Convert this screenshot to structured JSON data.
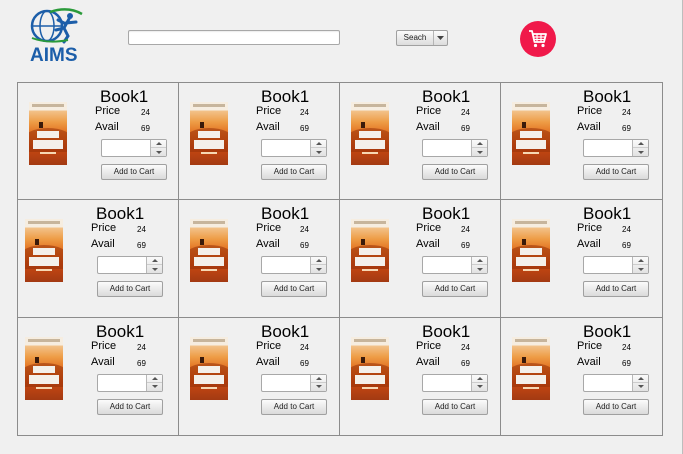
{
  "header": {
    "logo_text": "AIMS",
    "search_value": "",
    "search_button": "Seach",
    "cart_icon": "shopping-cart-icon",
    "cart_color": "#f0194a",
    "logo_color": "#1c5ea9"
  },
  "products": [
    {
      "title": "Book1",
      "price_label": "Price",
      "price": "24",
      "avail_label": "Avail",
      "avail": "69",
      "quantity": "",
      "add_label": "Add to Cart"
    },
    {
      "title": "Book1",
      "price_label": "Price",
      "price": "24",
      "avail_label": "Avail",
      "avail": "69",
      "quantity": "",
      "add_label": "Add to Cart"
    },
    {
      "title": "Book1",
      "price_label": "Price",
      "price": "24",
      "avail_label": "Avail",
      "avail": "69",
      "quantity": "",
      "add_label": "Add to Cart"
    },
    {
      "title": "Book1",
      "price_label": "Price",
      "price": "24",
      "avail_label": "Avail",
      "avail": "69",
      "quantity": "",
      "add_label": "Add to Cart"
    },
    {
      "title": "Book1",
      "price_label": "Price",
      "price": "24",
      "avail_label": "Avail",
      "avail": "69",
      "quantity": "",
      "add_label": "Add to Cart"
    },
    {
      "title": "Book1",
      "price_label": "Price",
      "price": "24",
      "avail_label": "Avail",
      "avail": "69",
      "quantity": "",
      "add_label": "Add to Cart"
    },
    {
      "title": "Book1",
      "price_label": "Price",
      "price": "24",
      "avail_label": "Avail",
      "avail": "69",
      "quantity": "",
      "add_label": "Add to Cart"
    },
    {
      "title": "Book1",
      "price_label": "Price",
      "price": "24",
      "avail_label": "Avail",
      "avail": "69",
      "quantity": "",
      "add_label": "Add to Cart"
    },
    {
      "title": "Book1",
      "price_label": "Price",
      "price": "24",
      "avail_label": "Avail",
      "avail": "69",
      "quantity": "",
      "add_label": "Add to Cart"
    },
    {
      "title": "Book1",
      "price_label": "Price",
      "price": "24",
      "avail_label": "Avail",
      "avail": "69",
      "quantity": "",
      "add_label": "Add to Cart"
    },
    {
      "title": "Book1",
      "price_label": "Price",
      "price": "24",
      "avail_label": "Avail",
      "avail": "69",
      "quantity": "",
      "add_label": "Add to Cart"
    },
    {
      "title": "Book1",
      "price_label": "Price",
      "price": "24",
      "avail_label": "Avail",
      "avail": "69",
      "quantity": "",
      "add_label": "Add to Cart"
    }
  ]
}
